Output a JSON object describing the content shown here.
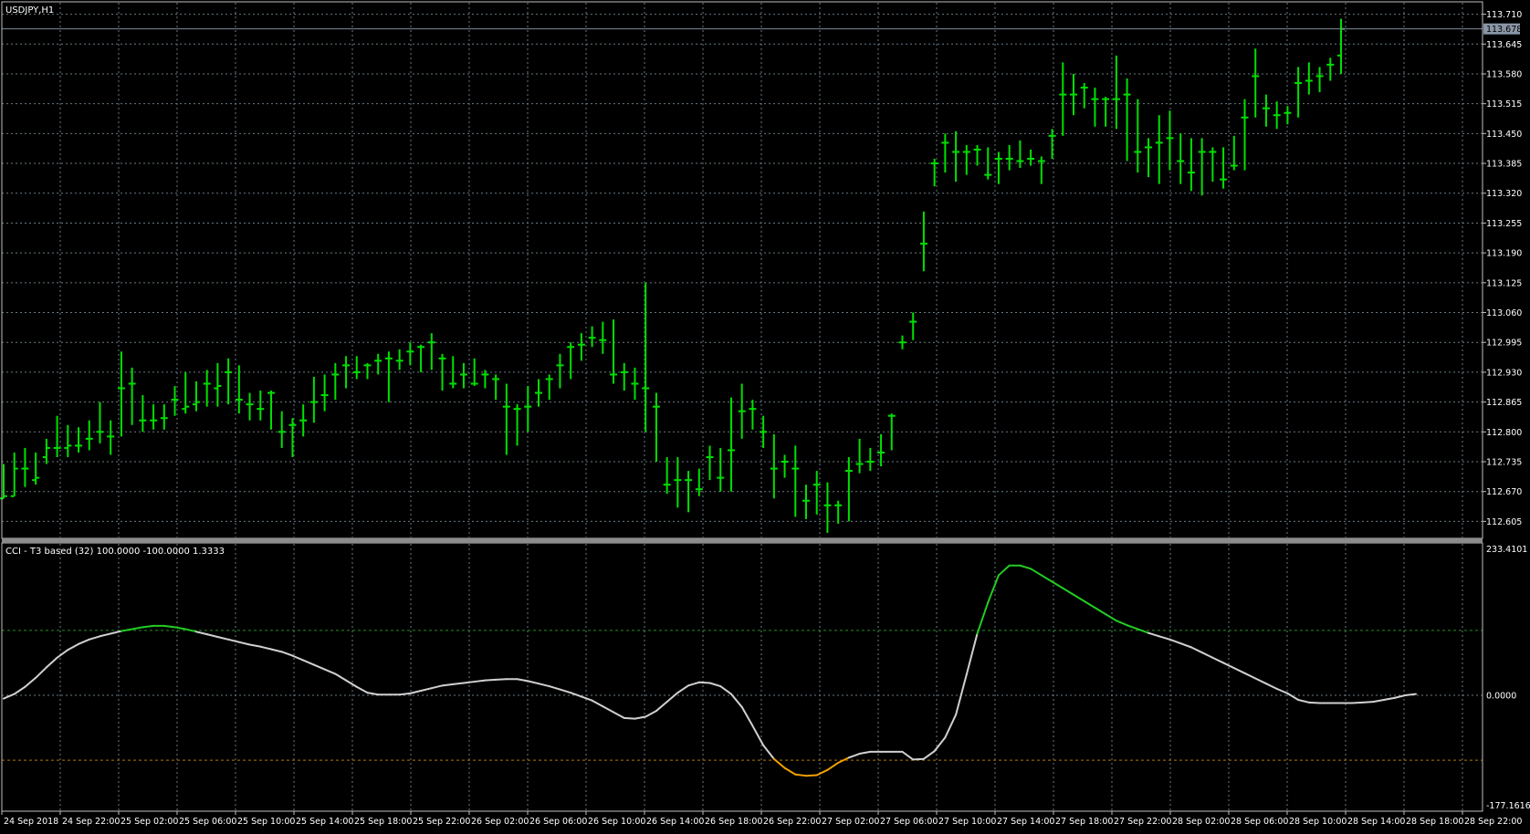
{
  "colors": {
    "background": "#000000",
    "grid": "#6a7a85",
    "frame": "#c0c0c0",
    "text": "#ffffff",
    "bull_bar": "#00e000",
    "cci_line": "#d0d0d0",
    "cci_up": "#22cc22",
    "cci_down": "#f0a000",
    "level_up": "#1f8f1f",
    "level_down": "#b07a00",
    "bid_line": "#7e8a99",
    "bid_badge": "#8a96a6"
  },
  "price_panel": {
    "title": "USDJPY,H1",
    "y_ticks": [
      "113.710",
      "113.645",
      "113.580",
      "113.515",
      "113.450",
      "113.385",
      "113.320",
      "113.255",
      "113.190",
      "113.125",
      "113.060",
      "112.995",
      "112.930",
      "112.865",
      "112.800",
      "112.735",
      "112.670",
      "112.605"
    ],
    "bid_label": "113.678"
  },
  "indicator_panel": {
    "title": "CCI - T3 based (32) 100.0000 -100.0000 1.3333",
    "max_label": "233.4101",
    "zero_label": "0.0000",
    "min_label": "-177.1616"
  },
  "x_ticks": [
    "24 Sep 2018",
    "24 Sep 22:00",
    "25 Sep 02:00",
    "25 Sep 06:00",
    "25 Sep 10:00",
    "25 Sep 14:00",
    "25 Sep 18:00",
    "25 Sep 22:00",
    "26 Sep 02:00",
    "26 Sep 06:00",
    "26 Sep 10:00",
    "26 Sep 14:00",
    "26 Sep 18:00",
    "26 Sep 22:00",
    "27 Sep 02:00",
    "27 Sep 06:00",
    "27 Sep 10:00",
    "27 Sep 14:00",
    "27 Sep 18:00",
    "27 Sep 22:00",
    "28 Sep 02:00",
    "28 Sep 06:00",
    "28 Sep 10:00",
    "28 Sep 14:00",
    "28 Sep 18:00",
    "28 Sep 22:00"
  ],
  "chart_data": [
    {
      "type": "ohlc",
      "symbol": "USDJPY",
      "timeframe": "H1",
      "ylim": [
        112.57,
        113.735
      ],
      "bars": [
        [
          112.655,
          112.73,
          112.655,
          112.66
        ],
        [
          112.66,
          112.755,
          112.66,
          112.72
        ],
        [
          112.72,
          112.765,
          112.68,
          112.72
        ],
        [
          112.695,
          112.755,
          112.685,
          112.7
        ],
        [
          112.745,
          112.785,
          112.73,
          112.765
        ],
        [
          112.765,
          112.835,
          112.745,
          112.765
        ],
        [
          112.765,
          112.815,
          112.745,
          112.77
        ],
        [
          112.77,
          112.81,
          112.755,
          112.77
        ],
        [
          112.785,
          112.825,
          112.76,
          112.785
        ],
        [
          112.8,
          112.865,
          112.775,
          112.8
        ],
        [
          112.79,
          112.825,
          112.75,
          112.79
        ],
        [
          112.895,
          112.975,
          112.79,
          112.895
        ],
        [
          112.905,
          112.94,
          112.815,
          112.905
        ],
        [
          112.825,
          112.88,
          112.8,
          112.825
        ],
        [
          112.825,
          112.86,
          112.805,
          112.825
        ],
        [
          112.83,
          112.86,
          112.805,
          112.83
        ],
        [
          112.87,
          112.9,
          112.835,
          112.87
        ],
        [
          112.85,
          112.93,
          112.84,
          112.855
        ],
        [
          112.86,
          112.91,
          112.845,
          112.865
        ],
        [
          112.905,
          112.935,
          112.855,
          112.905
        ],
        [
          112.895,
          112.95,
          112.855,
          112.9
        ],
        [
          112.93,
          112.96,
          112.86,
          112.93
        ],
        [
          112.87,
          112.945,
          112.84,
          112.87
        ],
        [
          112.86,
          112.885,
          112.825,
          112.86
        ],
        [
          112.85,
          112.89,
          112.825,
          112.85
        ],
        [
          112.885,
          112.89,
          112.805,
          112.885
        ],
        [
          112.8,
          112.845,
          112.765,
          112.8
        ],
        [
          112.815,
          112.83,
          112.745,
          112.815
        ],
        [
          112.825,
          112.86,
          112.79,
          112.825
        ],
        [
          112.865,
          112.92,
          112.82,
          112.865
        ],
        [
          112.88,
          112.925,
          112.845,
          112.88
        ],
        [
          112.925,
          112.95,
          112.87,
          112.925
        ],
        [
          112.945,
          112.965,
          112.895,
          112.945
        ],
        [
          112.93,
          112.965,
          112.915,
          112.93
        ],
        [
          112.945,
          112.95,
          112.915,
          112.945
        ],
        [
          112.955,
          112.97,
          112.925,
          112.955
        ],
        [
          112.96,
          112.975,
          112.865,
          112.96
        ],
        [
          112.955,
          112.98,
          112.935,
          112.955
        ],
        [
          112.975,
          112.995,
          112.945,
          112.975
        ],
        [
          112.985,
          112.99,
          112.93,
          112.985
        ],
        [
          112.995,
          113.015,
          112.935,
          112.995
        ],
        [
          112.96,
          112.97,
          112.89,
          112.96
        ],
        [
          112.905,
          112.965,
          112.895,
          112.905
        ],
        [
          112.925,
          112.95,
          112.895,
          112.925
        ],
        [
          112.905,
          112.96,
          112.9,
          112.905
        ],
        [
          112.925,
          112.935,
          112.895,
          112.925
        ],
        [
          112.915,
          112.925,
          112.87,
          112.915
        ],
        [
          112.855,
          112.905,
          112.75,
          112.855
        ],
        [
          112.85,
          112.86,
          112.77,
          112.85
        ],
        [
          112.855,
          112.9,
          112.8,
          112.855
        ],
        [
          112.885,
          112.915,
          112.855,
          112.885
        ],
        [
          112.915,
          112.925,
          112.87,
          112.915
        ],
        [
          112.945,
          112.97,
          112.895,
          112.945
        ],
        [
          112.985,
          112.995,
          112.915,
          112.985
        ],
        [
          112.99,
          113.015,
          112.955,
          112.99
        ],
        [
          113.005,
          113.03,
          112.985,
          113.005
        ],
        [
          113.0,
          113.04,
          112.97,
          113.0
        ],
        [
          112.925,
          113.045,
          112.905,
          112.925
        ],
        [
          112.93,
          112.95,
          112.89,
          112.93
        ],
        [
          112.905,
          112.94,
          112.87,
          112.905
        ],
        [
          112.895,
          113.125,
          112.8,
          112.895
        ],
        [
          112.855,
          112.885,
          112.735,
          112.855
        ],
        [
          112.685,
          112.745,
          112.665,
          112.685
        ],
        [
          112.695,
          112.745,
          112.635,
          112.695
        ],
        [
          112.695,
          112.715,
          112.625,
          112.695
        ],
        [
          112.675,
          112.72,
          112.66,
          112.675
        ],
        [
          112.745,
          112.77,
          112.695,
          112.745
        ],
        [
          112.7,
          112.765,
          112.67,
          112.7
        ],
        [
          112.76,
          112.875,
          112.67,
          112.76
        ],
        [
          112.845,
          112.905,
          112.785,
          112.845
        ],
        [
          112.85,
          112.87,
          112.805,
          112.85
        ],
        [
          112.8,
          112.835,
          112.765,
          112.8
        ],
        [
          112.72,
          112.795,
          112.655,
          112.72
        ],
        [
          112.735,
          112.75,
          112.7,
          112.735
        ],
        [
          112.72,
          112.77,
          112.615,
          112.72
        ],
        [
          112.65,
          112.685,
          112.61,
          112.65
        ],
        [
          112.685,
          112.715,
          112.62,
          112.685
        ],
        [
          112.64,
          112.69,
          112.58,
          112.64
        ],
        [
          112.64,
          112.65,
          112.6,
          112.64
        ],
        [
          112.715,
          112.745,
          112.605,
          112.715
        ],
        [
          112.73,
          112.785,
          112.71,
          112.73
        ],
        [
          112.735,
          112.765,
          112.715,
          112.735
        ],
        [
          112.755,
          112.795,
          112.725,
          112.755
        ],
        [
          112.835,
          112.84,
          112.76,
          112.835
        ],
        [
          112.995,
          113.01,
          112.98,
          112.995
        ],
        [
          113.04,
          113.06,
          113.0,
          113.04
        ],
        [
          113.21,
          113.28,
          113.15,
          113.21
        ],
        [
          113.385,
          113.395,
          113.335,
          113.385
        ],
        [
          113.43,
          113.45,
          113.365,
          113.43
        ],
        [
          113.41,
          113.455,
          113.345,
          113.41
        ],
        [
          113.41,
          113.425,
          113.36,
          113.41
        ],
        [
          113.415,
          113.425,
          113.38,
          113.415
        ],
        [
          113.36,
          113.42,
          113.35,
          113.36
        ],
        [
          113.395,
          113.41,
          113.34,
          113.395
        ],
        [
          113.395,
          113.425,
          113.37,
          113.395
        ],
        [
          113.39,
          113.435,
          113.375,
          113.39
        ],
        [
          113.395,
          113.415,
          113.38,
          113.395
        ],
        [
          113.39,
          113.4,
          113.34,
          113.39
        ],
        [
          113.445,
          113.46,
          113.395,
          113.445
        ],
        [
          113.535,
          113.605,
          113.445,
          113.535
        ],
        [
          113.535,
          113.58,
          113.49,
          113.535
        ],
        [
          113.55,
          113.56,
          113.505,
          113.55
        ],
        [
          113.525,
          113.55,
          113.465,
          113.525
        ],
        [
          113.525,
          113.53,
          113.465,
          113.525
        ],
        [
          113.525,
          113.62,
          113.46,
          113.525
        ],
        [
          113.535,
          113.57,
          113.39,
          113.535
        ],
        [
          113.41,
          113.525,
          113.365,
          113.41
        ],
        [
          113.42,
          113.44,
          113.355,
          113.42
        ],
        [
          113.43,
          113.49,
          113.34,
          113.43
        ],
        [
          113.44,
          113.5,
          113.37,
          113.44
        ],
        [
          113.39,
          113.45,
          113.34,
          113.39
        ],
        [
          113.365,
          113.44,
          113.325,
          113.365
        ],
        [
          113.41,
          113.44,
          113.315,
          113.41
        ],
        [
          113.41,
          113.42,
          113.345,
          113.41
        ],
        [
          113.35,
          113.42,
          113.33,
          113.35
        ],
        [
          113.38,
          113.445,
          113.37,
          113.38
        ],
        [
          113.485,
          113.525,
          113.37,
          113.485
        ],
        [
          113.575,
          113.635,
          113.485,
          113.575
        ],
        [
          113.505,
          113.535,
          113.465,
          113.505
        ],
        [
          113.49,
          113.52,
          113.46,
          113.49
        ],
        [
          113.495,
          113.51,
          113.47,
          113.495
        ],
        [
          113.56,
          113.595,
          113.485,
          113.56
        ],
        [
          113.565,
          113.605,
          113.535,
          113.565
        ],
        [
          113.575,
          113.595,
          113.54,
          113.575
        ],
        [
          113.6,
          113.615,
          113.565,
          113.6
        ],
        [
          113.62,
          113.7,
          113.58,
          113.678
        ]
      ]
    },
    {
      "type": "line",
      "name": "CCI - T3 based (32) 100.0000 -100.0000 1.3333",
      "ylim": [
        -177.1616,
        233.4101
      ],
      "levels": [
        100,
        0,
        -100
      ],
      "values": [
        -5,
        2,
        13,
        27,
        43,
        58,
        70,
        79,
        86,
        91,
        95,
        99,
        102,
        105,
        107,
        107,
        105,
        102,
        98,
        94,
        90,
        86,
        82,
        78,
        75,
        71,
        67,
        61,
        54,
        47,
        40,
        33,
        23,
        13,
        4,
        1,
        1,
        1,
        3,
        7,
        11,
        15,
        17,
        19,
        21,
        23,
        24,
        25,
        25,
        22,
        18,
        14,
        9,
        4,
        -2,
        -8,
        -17,
        -26,
        -35,
        -36,
        -33,
        -24,
        -10,
        4,
        15,
        20,
        19,
        14,
        2,
        -18,
        -47,
        -77,
        -98,
        -112,
        -122,
        -124,
        -123,
        -115,
        -104,
        -96,
        -90,
        -87,
        -87,
        -87,
        -87,
        -99,
        -98,
        -86,
        -65,
        -30,
        32,
        95,
        143,
        185,
        200,
        200,
        195,
        185,
        175,
        165,
        155,
        145,
        135,
        125,
        115,
        108,
        102,
        96,
        91,
        86,
        80,
        74,
        66,
        58,
        50,
        42,
        34,
        26,
        18,
        10,
        3,
        -7,
        -11,
        -12,
        -12,
        -12,
        -12,
        -11,
        -10,
        -7,
        -4,
        0,
        2
      ]
    }
  ]
}
